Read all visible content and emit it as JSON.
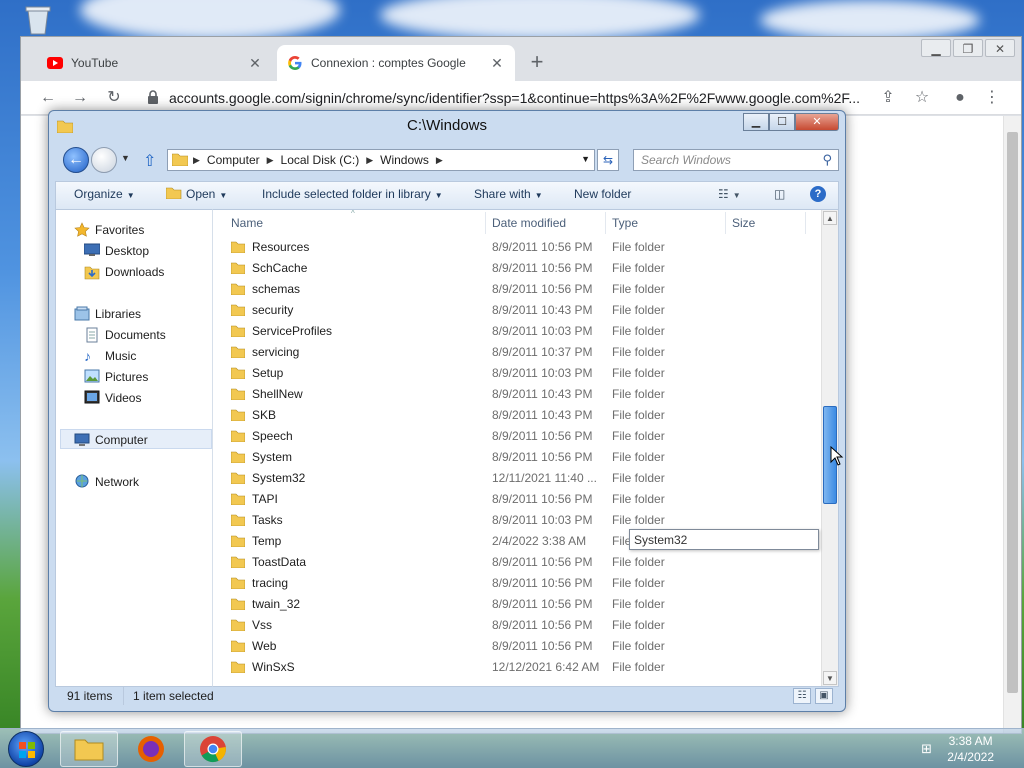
{
  "browser": {
    "tabs": [
      {
        "title": "YouTube",
        "favicon": "youtube-icon"
      },
      {
        "title": "Connexion : comptes Google",
        "favicon": "google-icon"
      }
    ],
    "url": "accounts.google.com/signin/chrome/sync/identifier?ssp=1&continue=https%3A%2F%2Fwww.google.com%2F..."
  },
  "explorer": {
    "title": "C:\\Windows",
    "breadcrumb": [
      "Computer",
      "Local Disk (C:)",
      "Windows"
    ],
    "search_placeholder": "Search Windows",
    "commands": {
      "organize": "Organize",
      "open": "Open",
      "include": "Include selected folder in library",
      "share": "Share with",
      "new_folder": "New folder"
    },
    "nav": {
      "favorites": "Favorites",
      "desktop": "Desktop",
      "downloads": "Downloads",
      "libraries": "Libraries",
      "documents": "Documents",
      "music": "Music",
      "pictures": "Pictures",
      "videos": "Videos",
      "computer": "Computer",
      "network": "Network"
    },
    "columns": {
      "name": "Name",
      "date": "Date modified",
      "type": "Type",
      "size": "Size"
    },
    "files": [
      {
        "name": "Resources",
        "date": "8/9/2011 10:56 PM",
        "type": "File folder"
      },
      {
        "name": "SchCache",
        "date": "8/9/2011 10:56 PM",
        "type": "File folder"
      },
      {
        "name": "schemas",
        "date": "8/9/2011 10:56 PM",
        "type": "File folder"
      },
      {
        "name": "security",
        "date": "8/9/2011 10:43 PM",
        "type": "File folder"
      },
      {
        "name": "ServiceProfiles",
        "date": "8/9/2011 10:03 PM",
        "type": "File folder"
      },
      {
        "name": "servicing",
        "date": "8/9/2011 10:37 PM",
        "type": "File folder"
      },
      {
        "name": "Setup",
        "date": "8/9/2011 10:03 PM",
        "type": "File folder"
      },
      {
        "name": "ShellNew",
        "date": "8/9/2011 10:43 PM",
        "type": "File folder"
      },
      {
        "name": "SKB",
        "date": "8/9/2011 10:43 PM",
        "type": "File folder"
      },
      {
        "name": "Speech",
        "date": "8/9/2011 10:56 PM",
        "type": "File folder"
      },
      {
        "name": "System",
        "date": "8/9/2011 10:56 PM",
        "type": "File folder"
      },
      {
        "name": "System32",
        "date": "12/11/2021 11:40 ...",
        "type": "File folder"
      },
      {
        "name": "TAPI",
        "date": "8/9/2011 10:56 PM",
        "type": "File folder"
      },
      {
        "name": "Tasks",
        "date": "8/9/2011 10:03 PM",
        "type": "File folder"
      },
      {
        "name": "Temp",
        "date": "2/4/2022 3:38 AM",
        "type": "File"
      },
      {
        "name": "ToastData",
        "date": "8/9/2011 10:56 PM",
        "type": "File folder"
      },
      {
        "name": "tracing",
        "date": "8/9/2011 10:56 PM",
        "type": "File folder"
      },
      {
        "name": "twain_32",
        "date": "8/9/2011 10:56 PM",
        "type": "File folder"
      },
      {
        "name": "Vss",
        "date": "8/9/2011 10:56 PM",
        "type": "File folder"
      },
      {
        "name": "Web",
        "date": "8/9/2011 10:56 PM",
        "type": "File folder"
      },
      {
        "name": "WinSxS",
        "date": "12/12/2021 6:42 AM",
        "type": "File folder"
      }
    ],
    "tooltip": "System32",
    "status": {
      "count": "91 items",
      "selected": "1 item selected"
    }
  },
  "taskbar": {
    "time": "3:38 AM",
    "date": "2/4/2022"
  }
}
